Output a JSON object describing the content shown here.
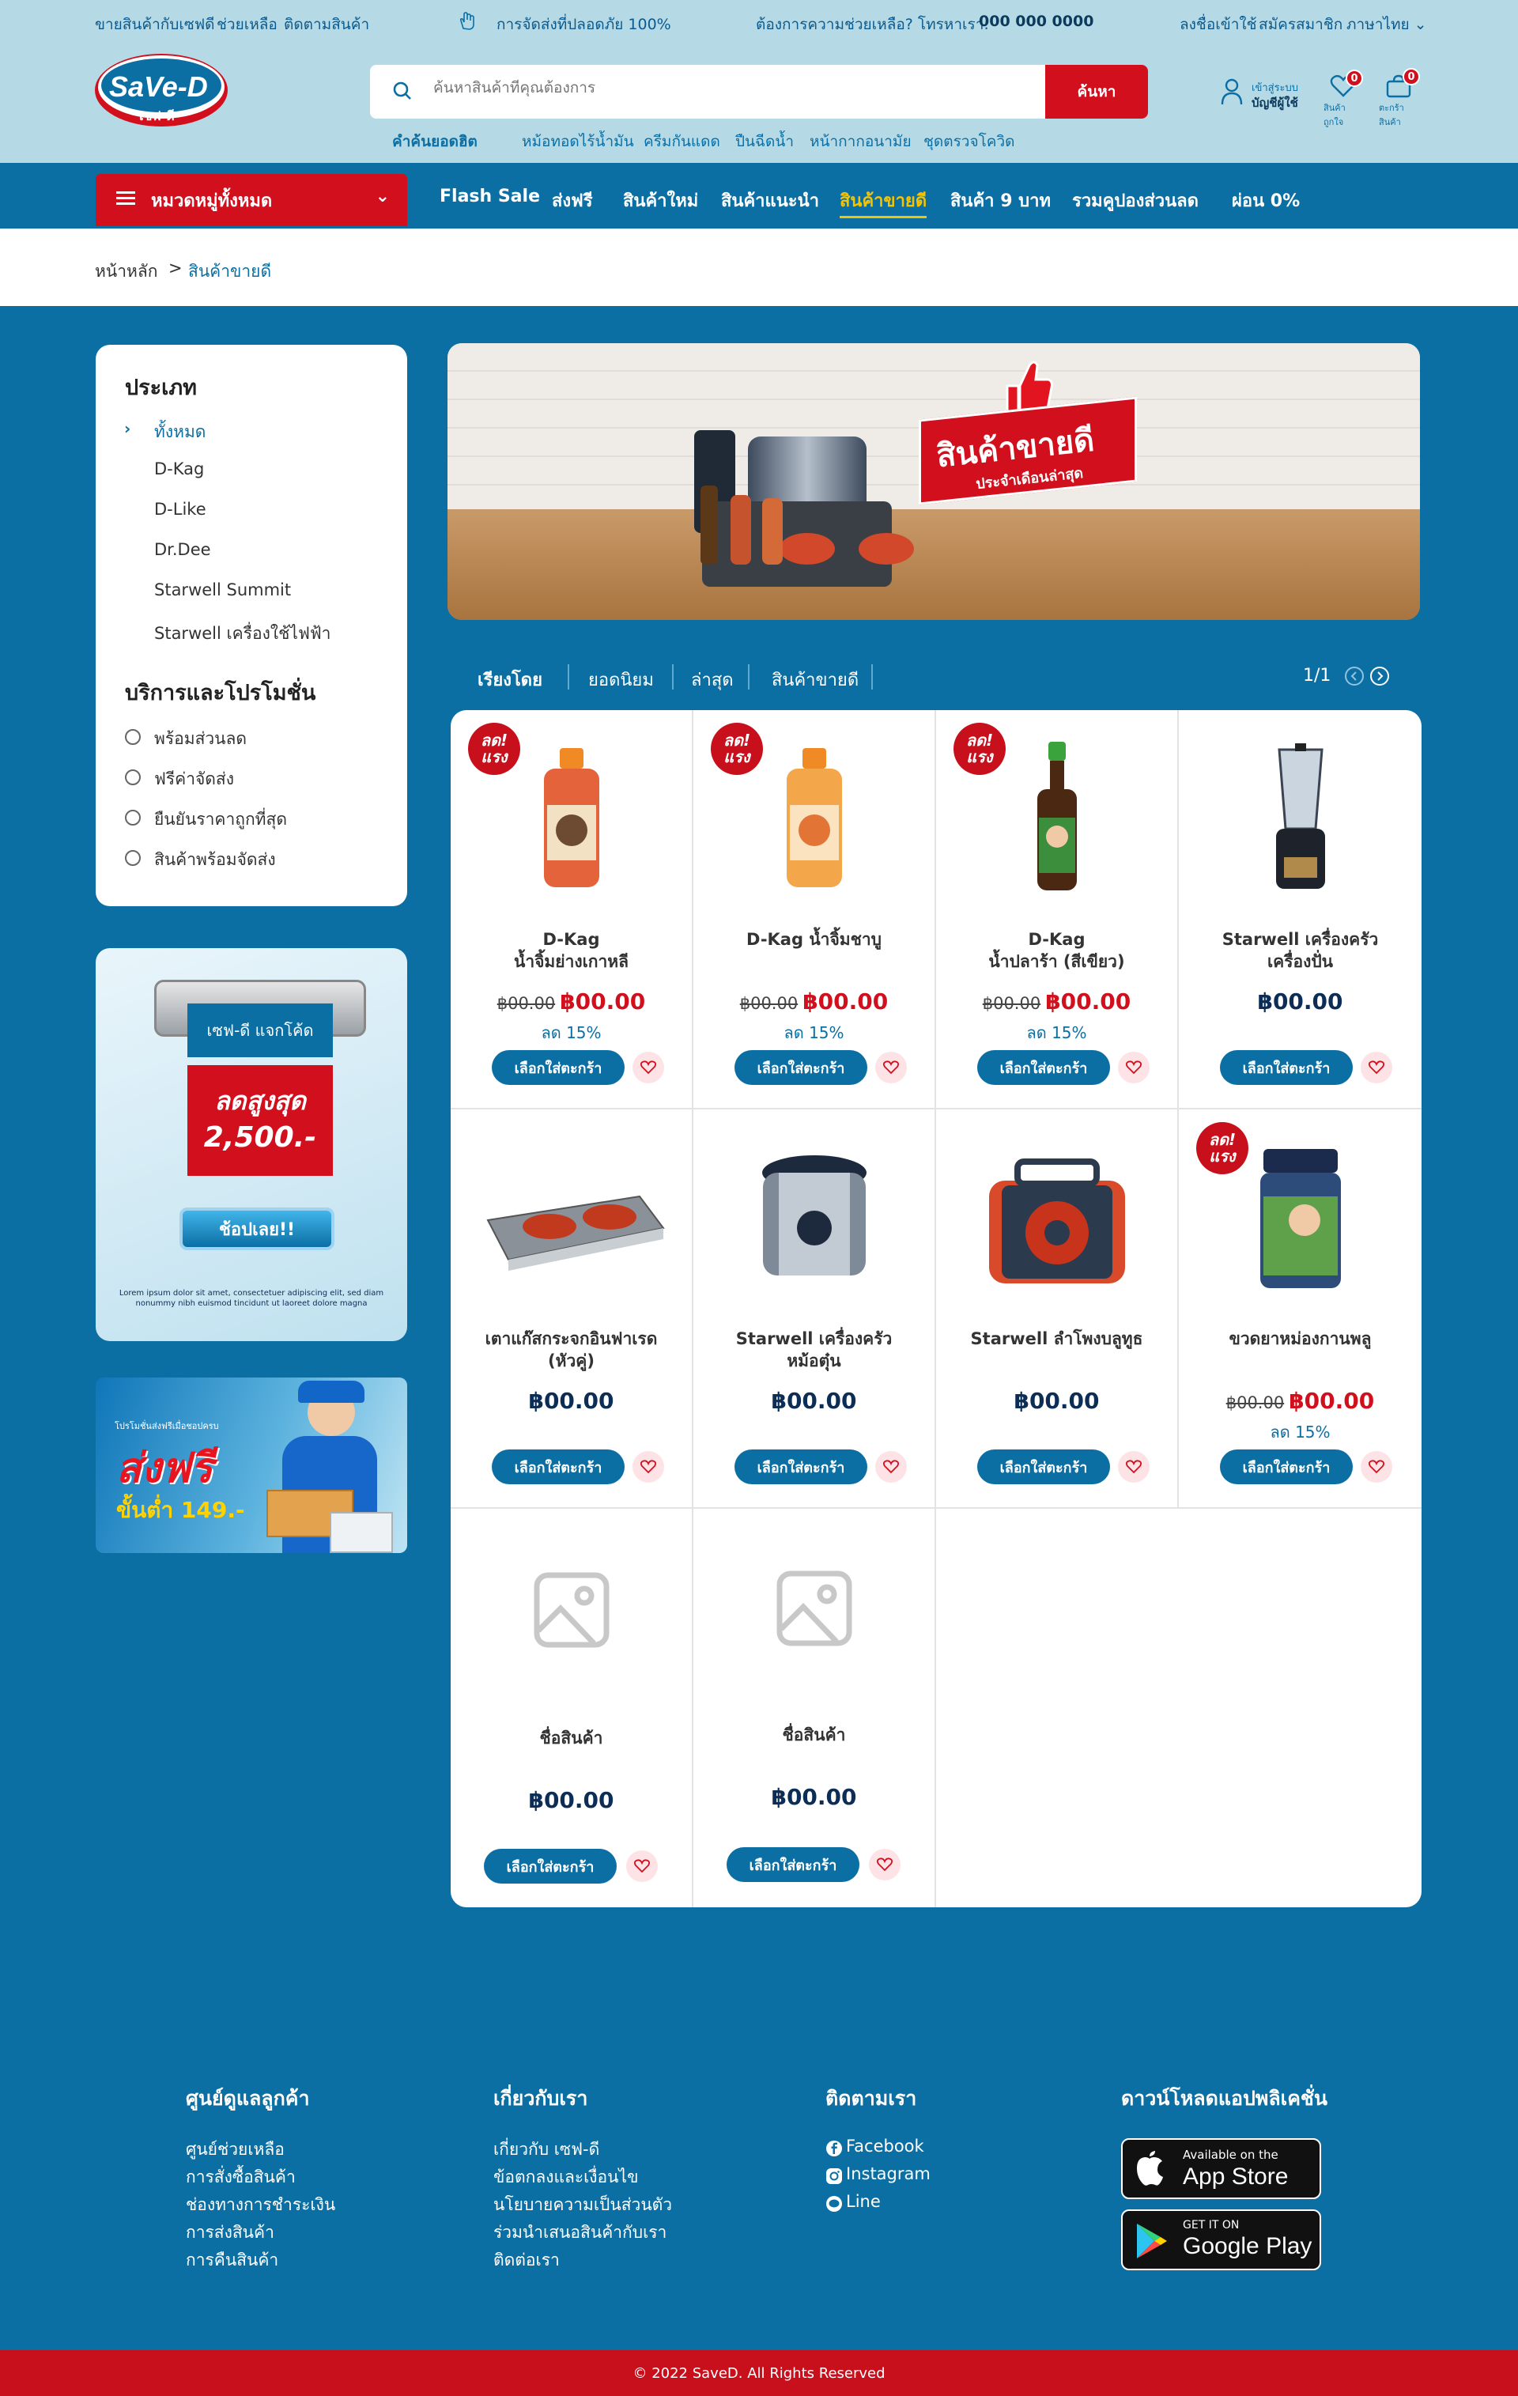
{
  "topbar": {
    "link1": "ขายสินค้ากับเซฟดี",
    "link2": "ช่วยเหลือ",
    "link3": "ติดตามสินค้า",
    "safety": "การจัดส่งที่ปลอดภัย 100%",
    "help": "ต้องการความช่วยเหลือ? โทรหาเรา:",
    "phone": "000 000 0000",
    "login": "ลงชื่อเข้าใช้",
    "register": "สมัครสมาชิก",
    "language": "ภาษาไทย"
  },
  "logo": {
    "main": "SaVe-D",
    "sub": "เซฟ-ดี"
  },
  "search": {
    "placeholder": "ค้นหาสินค้าที่คุณต้องการ",
    "button": "ค้นหา"
  },
  "hot_search": {
    "label": "คำค้นยอดฮิต",
    "items": [
      "หม้อทอดไร้น้ำมัน",
      "ครีมกันแดด",
      "ปืนฉีดน้ำ",
      "หน้ากากอนามัย",
      "ชุดตรวจโควิด"
    ]
  },
  "account": {
    "line1": "เข้าสู่ระบบ",
    "line2": "บัญชีผู้ใช้",
    "wishlist": "สินค้าถูกใจ",
    "wishlist_count": "0",
    "cart": "ตะกร้าสินค้า",
    "cart_count": "0"
  },
  "nav": {
    "category": "หมวดหมู่ทั้งหมด",
    "items": [
      "Flash Sale",
      "ส่งฟรี",
      "สินค้าใหม่",
      "สินค้าแนะนำ",
      "สินค้าขายดี",
      "สินค้า 9 บาท",
      "รวมคูปองส่วนลด",
      "ผ่อน 0%"
    ]
  },
  "breadcrumb": {
    "home": "หน้าหลัก",
    "sep": ">",
    "current": "สินค้าขายดี"
  },
  "sidebar": {
    "type_title": "ประเภท",
    "types": [
      "ทั้งหมด",
      "D-Kag",
      "D-Like",
      "Dr.Dee",
      "Starwell Summit",
      "Starwell เครื่องใช้ไฟฟ้า"
    ],
    "promo_title": "บริการและโปรโมชั่น",
    "promos": [
      "พร้อมส่วนลด",
      "ฟรีค่าจัดส่ง",
      "ยืนยันราคาถูกที่สุด",
      "สินค้าพร้อมจัดส่ง"
    ]
  },
  "coupon": {
    "tag": "เซฟ-ดี แจกโค้ด",
    "line1": "ลดสูงสุด",
    "line2": "2,500.-",
    "button": "ช้อปเลย!!",
    "desc": "Lorem ipsum dolor sit amet, consectetuer adipiscing elit, sed diam nonummy nibh euismod tincidunt ut laoreet dolore magna"
  },
  "promo_free": {
    "small": "โปรโมชั่นส่งฟรีเมื่อชอปครบ",
    "big": "ส่งฟรี",
    "min": "ขั้นต่ำ 149.-"
  },
  "banner": {
    "title": "สินค้าขายดี",
    "subtitle": "ประจำเดือนล่าสุด"
  },
  "sort": {
    "label": "เรียงโดย",
    "options": [
      "ยอดนิยม",
      "ล่าสุด",
      "สินค้าขายดี"
    ],
    "page": "1/1"
  },
  "sale_badge": "ลด! แรง",
  "cart_button": "เลือกใส่ตะกร้า",
  "products": [
    {
      "name1": "D-Kag",
      "name2": "น้ำจิ้มย่างเกาหลี",
      "old": "฿00.00",
      "price": "฿00.00",
      "discount": "ลด 15%"
    },
    {
      "name1": "D-Kag น้ำจิ้มชาบู",
      "name2": "",
      "old": "฿00.00",
      "price": "฿00.00",
      "discount": "ลด 15%"
    },
    {
      "name1": "D-Kag",
      "name2": "น้ำปลาร้า (สีเขียว)",
      "old": "฿00.00",
      "price": "฿00.00",
      "discount": "ลด 15%"
    },
    {
      "name1": "Starwell เครื่องครัว",
      "name2": "เครื่องปั่น",
      "old": "",
      "price": "฿00.00",
      "discount": ""
    },
    {
      "name1": "เตาแก๊สกระจกอินฟาเรด",
      "name2": "(หัวคู่)",
      "old": "",
      "price": "฿00.00",
      "discount": ""
    },
    {
      "name1": "Starwell เครื่องครัว",
      "name2": "หม้อตุ๋น",
      "old": "",
      "price": "฿00.00",
      "discount": ""
    },
    {
      "name1": "Starwell ลำโพงบลูทูธ",
      "name2": "",
      "old": "",
      "price": "฿00.00",
      "discount": ""
    },
    {
      "name1": "ขวดยาหม่องกานพลู",
      "name2": "",
      "old": "฿00.00",
      "price": "฿00.00",
      "discount": "ลด 15%"
    },
    {
      "name1": "ชื่อสินค้า",
      "name2": "",
      "old": "",
      "price": "฿00.00",
      "discount": ""
    },
    {
      "name1": "ชื่อสินค้า",
      "name2": "",
      "old": "",
      "price": "฿00.00",
      "discount": ""
    }
  ],
  "footer": {
    "col1": {
      "title": "ศูนย์ดูแลลูกค้า",
      "links": [
        "ศูนย์ช่วยเหลือ",
        "การสั่งซื้อสินค้า",
        "ช่องทางการชำระเงิน",
        "การส่งสินค้า",
        "การคืนสินค้า"
      ]
    },
    "col2": {
      "title": "เกี่ยวกับเรา",
      "links": [
        "เกี่ยวกับ เซฟ-ดี",
        "ข้อตกลงและเงื่อนไข",
        "นโยบายความเป็นส่วนตัว",
        "ร่วมนำเสนอสินค้ากับเรา",
        "ติดต่อเรา"
      ]
    },
    "col3": {
      "title": "ติดตามเรา",
      "links": [
        "Facebook",
        "Instagram",
        "Line"
      ]
    },
    "col4": {
      "title": "ดาวน์โหลดแอปพลิเคชั่น",
      "appstore_small": "Available on the",
      "appstore_big": "App Store",
      "play_small": "GET IT ON",
      "play_big": "Google Play"
    }
  },
  "copyright": "© 2022 SaveD. All Rights Reserved",
  "colors": {
    "primary": "#0b6fa4",
    "accent": "#d20f1d",
    "topbar": "#b5dae6",
    "active_nav": "#f5c400"
  }
}
